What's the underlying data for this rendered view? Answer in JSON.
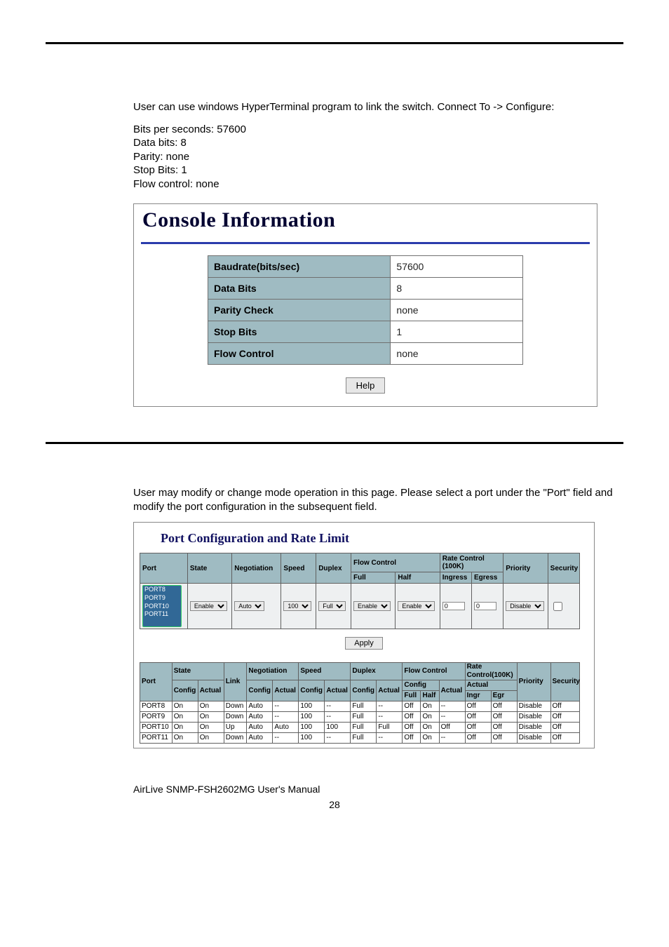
{
  "section1": {
    "intro": "User can use windows HyperTerminal program to link the switch. Connect To -> Configure:",
    "settings_lines": [
      "Bits per seconds: 57600",
      "Data bits: 8",
      "Parity: none",
      "Stop Bits: 1",
      "Flow control: none"
    ],
    "panel_title": "Console Information",
    "rows": [
      {
        "label": "Baudrate(bits/sec)",
        "value": "57600"
      },
      {
        "label": "Data Bits",
        "value": "8"
      },
      {
        "label": "Parity Check",
        "value": "none"
      },
      {
        "label": "Stop Bits",
        "value": "1"
      },
      {
        "label": "Flow Control",
        "value": "none"
      }
    ],
    "help_label": "Help"
  },
  "section2": {
    "intro": "User may modify or change mode operation in this page.  Please select a port under the \"Port\" field and modify the port configuration in the subsequent field.",
    "panel_title": "Port Configuration and Rate Limit",
    "cfg_headers": {
      "port": "Port",
      "state": "State",
      "negotiation": "Negotiation",
      "speed": "Speed",
      "duplex": "Duplex",
      "flow": "Flow Control",
      "full": "Full",
      "half": "Half",
      "rate": "Rate Control (100K)",
      "ingress": "Ingress",
      "egress": "Egress",
      "priority": "Priority",
      "security": "Security"
    },
    "cfg_ports": [
      "PORT8",
      "PORT9",
      "PORT10",
      "PORT11"
    ],
    "cfg_values": {
      "state": "Enable",
      "negotiation": "Auto",
      "speed": "100",
      "duplex": "Full",
      "flow_full": "Enable",
      "flow_half": "Enable",
      "ingress": "0",
      "egress": "0",
      "priority": "Disable",
      "security_checked": false
    },
    "apply_label": "Apply",
    "status_headers": {
      "port": "Port",
      "state": "State",
      "config": "Config",
      "actual": "Actual",
      "link": "Link",
      "negotiation": "Negotiation",
      "speed": "Speed",
      "duplex": "Duplex",
      "flow": "Flow Control",
      "full": "Full",
      "half": "Half",
      "rate": "Rate Control(100K)",
      "ingr": "Ingr",
      "egr": "Egr",
      "priority": "Priority",
      "security": "Security"
    },
    "status_rows": [
      {
        "port": "PORT8",
        "scfg": "On",
        "sact": "On",
        "link": "Down",
        "ncfg": "Auto",
        "nact": "--",
        "spcfg": "100",
        "spact": "--",
        "dcfg": "Full",
        "dact": "--",
        "ffull": "Off",
        "fhalf": "On",
        "fact": "--",
        "ringr": "Off",
        "regr": "Off",
        "prio": "Disable",
        "sec": "Off"
      },
      {
        "port": "PORT9",
        "scfg": "On",
        "sact": "On",
        "link": "Down",
        "ncfg": "Auto",
        "nact": "--",
        "spcfg": "100",
        "spact": "--",
        "dcfg": "Full",
        "dact": "--",
        "ffull": "Off",
        "fhalf": "On",
        "fact": "--",
        "ringr": "Off",
        "regr": "Off",
        "prio": "Disable",
        "sec": "Off"
      },
      {
        "port": "PORT10",
        "scfg": "On",
        "sact": "On",
        "link": "Up",
        "ncfg": "Auto",
        "nact": "Auto",
        "spcfg": "100",
        "spact": "100",
        "dcfg": "Full",
        "dact": "Full",
        "ffull": "Off",
        "fhalf": "On",
        "fact": "Off",
        "ringr": "Off",
        "regr": "Off",
        "prio": "Disable",
        "sec": "Off"
      },
      {
        "port": "PORT11",
        "scfg": "On",
        "sact": "On",
        "link": "Down",
        "ncfg": "Auto",
        "nact": "--",
        "spcfg": "100",
        "spact": "--",
        "dcfg": "Full",
        "dact": "--",
        "ffull": "Off",
        "fhalf": "On",
        "fact": "--",
        "ringr": "Off",
        "regr": "Off",
        "prio": "Disable",
        "sec": "Off"
      }
    ]
  },
  "footer": "AirLive SNMP-FSH2602MG User's Manual",
  "page_number": "28"
}
